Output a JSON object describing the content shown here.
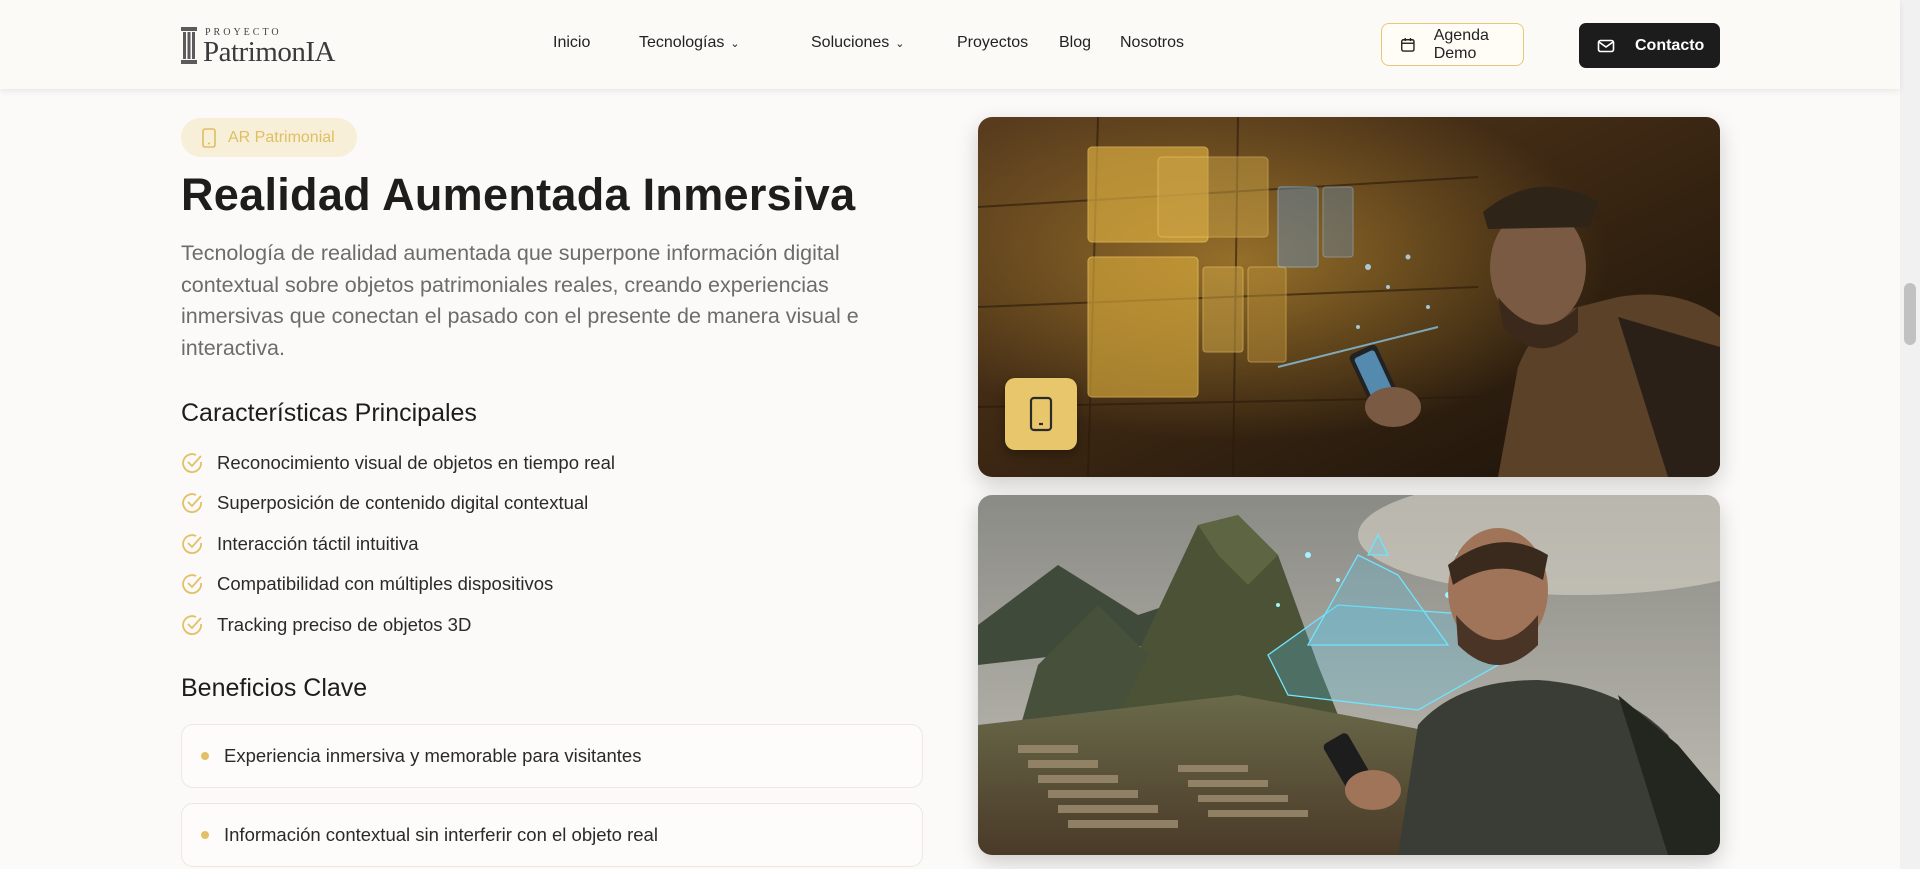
{
  "header": {
    "logo": {
      "small": "PROYECTO",
      "main": "PatrimonIA"
    },
    "nav": [
      {
        "label": "Inicio",
        "icon": ""
      },
      {
        "label": "Tecnologías",
        "icon": "chevron-down-icon"
      },
      {
        "label": "Soluciones",
        "icon": "chevron-down-icon"
      },
      {
        "label": "Proyectos",
        "icon": ""
      },
      {
        "label": "Blog",
        "icon": ""
      },
      {
        "label": "Nosotros",
        "icon": ""
      }
    ],
    "demo_button": {
      "label": "Agenda Demo",
      "icon": "calendar-icon"
    },
    "contact_button": {
      "label": "Contacto",
      "icon": "mail-icon"
    }
  },
  "main": {
    "badge": {
      "label": "AR Patrimonial",
      "icon": "smartphone-icon"
    },
    "title": "Realidad Aumentada Inmersiva",
    "description": "Tecnología de realidad aumentada que superpone información digital contextual sobre objetos patrimoniales reales, creando experiencias inmersivas que conectan el pasado con el presente de manera visual e interactiva.",
    "features_heading": "Características Principales",
    "features": [
      "Reconocimiento visual de objetos en tiempo real",
      "Superposición de contenido digital contextual",
      "Interacción táctil intuitiva",
      "Compatibilidad con múltiples dispositivos",
      "Tracking preciso de objetos 3D"
    ],
    "benefits_heading": "Beneficios Clave",
    "benefits": [
      "Experiencia inmersiva y memorable para visitantes",
      "Información contextual sin interferir con el objeto real"
    ]
  },
  "images": [
    {
      "name": "ar-museum-image",
      "overlay_icon": "smartphone-icon"
    },
    {
      "name": "ar-machu-picchu-image"
    }
  ],
  "colors": {
    "accent": "#e3c066",
    "dark": "#1c1c1c",
    "background": "#fbfaf8"
  }
}
